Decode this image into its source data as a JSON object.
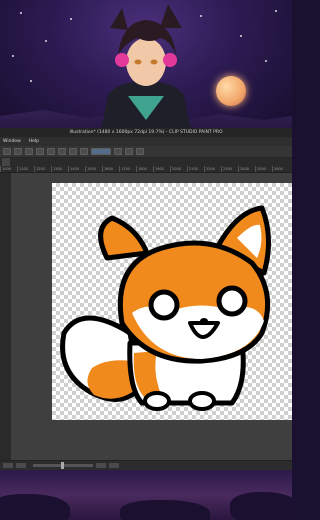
{
  "window": {
    "title": "Illustration* (1480 x 1600px 72dpi 19.7%) - CLIP STUDIO PAINT PRO"
  },
  "menubar": {
    "items": [
      "Window",
      "Help"
    ]
  },
  "ruler": {
    "ticks": [
      "1000",
      "1100",
      "1200",
      "1300",
      "1400",
      "1500",
      "1600",
      "1700",
      "1800",
      "1900",
      "2000",
      "2100",
      "2200",
      "2300",
      "2400",
      "2500",
      "2600"
    ]
  },
  "colors": {
    "fox_orange": "#f08a1c",
    "outline": "#000000",
    "ui_dark": "#3c3c3c",
    "space_purple": "#2c1b52"
  },
  "icons": {
    "artwork_top": "anime-character-illustration",
    "canvas_content": "fox-sticker-drawing"
  }
}
